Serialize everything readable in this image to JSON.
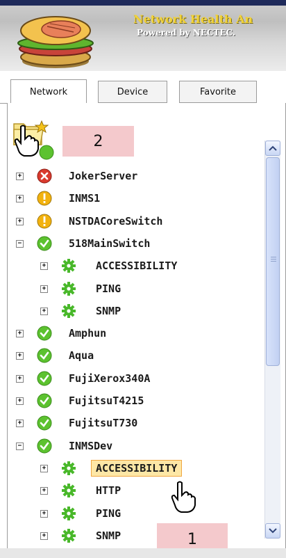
{
  "app": {
    "title": "Network Health An",
    "subtitle": "Powered by NECTEC."
  },
  "tabs": [
    {
      "label": "Network",
      "active": true
    },
    {
      "label": "Device",
      "active": false
    },
    {
      "label": "Favorite",
      "active": false
    }
  ],
  "annotations": {
    "step1": "1",
    "step2": "2"
  },
  "tree": [
    {
      "label": "JokerServer",
      "status": "error",
      "expander": "+"
    },
    {
      "label": "INMS1",
      "status": "warning",
      "expander": "+"
    },
    {
      "label": "NSTDACoreSwitch",
      "status": "warning",
      "expander": "+"
    },
    {
      "label": "518MainSwitch",
      "status": "ok",
      "expander": "−",
      "children": [
        {
          "label": "ACCESSIBILITY",
          "expander": "+"
        },
        {
          "label": "PING",
          "expander": "+"
        },
        {
          "label": "SNMP",
          "expander": "+"
        }
      ]
    },
    {
      "label": "Amphun",
      "status": "ok",
      "expander": "+"
    },
    {
      "label": "Aqua",
      "status": "ok",
      "expander": "+"
    },
    {
      "label": "FujiXerox340A",
      "status": "ok",
      "expander": "+"
    },
    {
      "label": "FujitsuT4215",
      "status": "ok",
      "expander": "+"
    },
    {
      "label": "FujitsuT730",
      "status": "ok",
      "expander": "+"
    },
    {
      "label": "INMSDev",
      "status": "ok",
      "expander": "−",
      "children": [
        {
          "label": "ACCESSIBILITY",
          "expander": "+",
          "selected": true
        },
        {
          "label": "HTTP",
          "expander": "+"
        },
        {
          "label": "PING",
          "expander": "+"
        },
        {
          "label": "SNMP",
          "expander": "+"
        }
      ]
    }
  ],
  "colors": {
    "ok": "#5cc22f",
    "warning": "#f2b20f",
    "error": "#d93a2e",
    "gear": "#49b82a"
  }
}
